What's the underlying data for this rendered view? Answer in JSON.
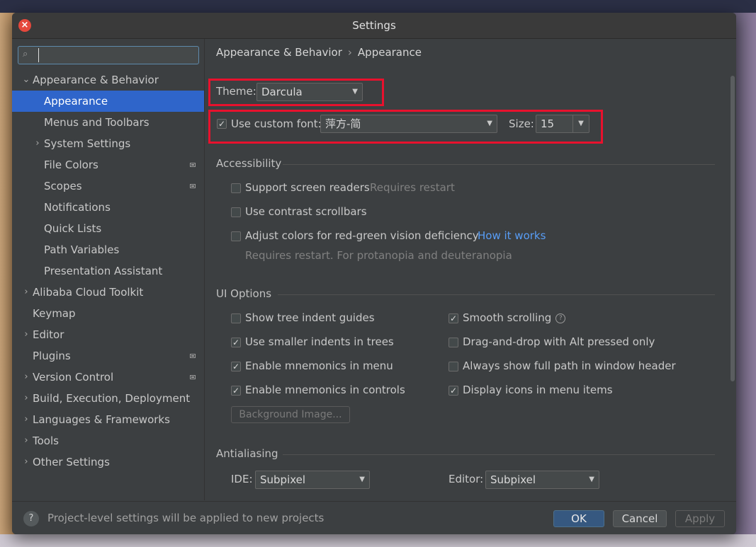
{
  "window": {
    "title": "Settings"
  },
  "search": {
    "placeholder": "",
    "value": ""
  },
  "sidebar": {
    "items": [
      {
        "label": "Appearance & Behavior",
        "arrow": "⌄",
        "level": 0,
        "name": "sidebar-item-appearance-behavior"
      },
      {
        "label": "Appearance",
        "arrow": "",
        "level": 1,
        "selected": true,
        "name": "sidebar-item-appearance"
      },
      {
        "label": "Menus and Toolbars",
        "arrow": "",
        "level": 1,
        "name": "sidebar-item-menus-toolbars"
      },
      {
        "label": "System Settings",
        "arrow": "›",
        "level": 1,
        "name": "sidebar-item-system-settings"
      },
      {
        "label": "File Colors",
        "arrow": "",
        "level": 1,
        "badge": true,
        "name": "sidebar-item-file-colors"
      },
      {
        "label": "Scopes",
        "arrow": "",
        "level": 1,
        "badge": true,
        "name": "sidebar-item-scopes"
      },
      {
        "label": "Notifications",
        "arrow": "",
        "level": 1,
        "name": "sidebar-item-notifications"
      },
      {
        "label": "Quick Lists",
        "arrow": "",
        "level": 1,
        "name": "sidebar-item-quick-lists"
      },
      {
        "label": "Path Variables",
        "arrow": "",
        "level": 1,
        "name": "sidebar-item-path-variables"
      },
      {
        "label": "Presentation Assistant",
        "arrow": "",
        "level": 1,
        "name": "sidebar-item-presentation-assistant"
      },
      {
        "label": "Alibaba Cloud Toolkit",
        "arrow": "›",
        "level": 0,
        "name": "sidebar-item-alibaba-cloud-toolkit"
      },
      {
        "label": "Keymap",
        "arrow": "",
        "level": 0,
        "name": "sidebar-item-keymap"
      },
      {
        "label": "Editor",
        "arrow": "›",
        "level": 0,
        "name": "sidebar-item-editor"
      },
      {
        "label": "Plugins",
        "arrow": "",
        "level": 0,
        "badge": true,
        "name": "sidebar-item-plugins"
      },
      {
        "label": "Version Control",
        "arrow": "›",
        "level": 0,
        "badge": true,
        "name": "sidebar-item-version-control"
      },
      {
        "label": "Build, Execution, Deployment",
        "arrow": "›",
        "level": 0,
        "name": "sidebar-item-build-execution-deployment"
      },
      {
        "label": "Languages & Frameworks",
        "arrow": "›",
        "level": 0,
        "name": "sidebar-item-languages-frameworks"
      },
      {
        "label": "Tools",
        "arrow": "›",
        "level": 0,
        "name": "sidebar-item-tools"
      },
      {
        "label": "Other Settings",
        "arrow": "›",
        "level": 0,
        "name": "sidebar-item-other-settings"
      }
    ]
  },
  "main": {
    "breadcrumb": {
      "parent": "Appearance & Behavior",
      "sep": "›",
      "current": "Appearance"
    },
    "theme": {
      "label": "Theme:",
      "value": "Darcula"
    },
    "font": {
      "checked": true,
      "label": "Use custom font:",
      "value": "萍方-简",
      "size_label": "Size:",
      "size_value": "15"
    },
    "accessibility": {
      "title": "Accessibility",
      "screen_readers": {
        "checked": false,
        "label": "Support screen readers",
        "hint": "Requires restart"
      },
      "contrast_scrollbars": {
        "checked": false,
        "label": "Use contrast scrollbars"
      },
      "red_green": {
        "checked": false,
        "label": "Adjust colors for red-green vision deficiency",
        "link": "How it works",
        "hint": "Requires restart. For protanopia and deuteranopia"
      }
    },
    "ui_options": {
      "title": "UI Options",
      "tree_indent_guides": {
        "checked": false,
        "label": "Show tree indent guides"
      },
      "smaller_indents": {
        "checked": true,
        "label": "Use smaller indents in trees"
      },
      "mnemonics_menu": {
        "checked": true,
        "label": "Enable mnemonics in menu"
      },
      "mnemonics_controls": {
        "checked": true,
        "label": "Enable mnemonics in controls"
      },
      "smooth_scrolling": {
        "checked": true,
        "label": "Smooth scrolling"
      },
      "drag_drop_alt": {
        "checked": false,
        "label": "Drag-and-drop with Alt pressed only"
      },
      "full_path": {
        "checked": false,
        "label": "Always show full path in window header"
      },
      "icons_menu": {
        "checked": true,
        "label": "Display icons in menu items"
      },
      "background_image_label": "Background Image..."
    },
    "antialiasing": {
      "title": "Antialiasing",
      "ide_label": "IDE:",
      "ide_value": "Subpixel",
      "editor_label": "Editor:",
      "editor_value": "Subpixel"
    }
  },
  "footer": {
    "help": "?",
    "text": "Project-level settings will be applied to new projects",
    "ok": "OK",
    "cancel": "Cancel",
    "apply": "Apply"
  },
  "icons": {
    "close": "close-icon",
    "search": "search-icon",
    "help": "question-circle-icon",
    "check": "✓"
  },
  "colors": {
    "selection": "#2f65ca",
    "highlight": "#e8112d",
    "link": "#589df6",
    "close": "#e5483c"
  }
}
